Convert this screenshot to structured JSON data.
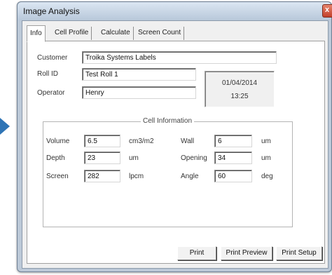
{
  "window": {
    "title": "Image Analysis",
    "close_glyph": "x"
  },
  "tabs": [
    {
      "label": "Info",
      "active": true
    },
    {
      "label": "Cell Profile",
      "active": false
    },
    {
      "label": "Calculate",
      "active": false
    },
    {
      "label": "Screen Count",
      "active": false
    }
  ],
  "info": {
    "customer_label": "Customer",
    "customer_value": "Troika Systems Labels",
    "roll_id_label": "Roll ID",
    "roll_id_value": "Test Roll 1",
    "operator_label": "Operator",
    "operator_value": "Henry",
    "date": "01/04/2014",
    "time": "13:25"
  },
  "cell_information": {
    "title": "Cell Information",
    "volume_label": "Volume",
    "volume_value": "6.5",
    "volume_unit": "cm3/m2",
    "depth_label": "Depth",
    "depth_value": "23",
    "depth_unit": "um",
    "screen_label": "Screen",
    "screen_value": "282",
    "screen_unit": "lpcm",
    "wall_label": "Wall",
    "wall_value": "6",
    "wall_unit": "um",
    "opening_label": "Opening",
    "opening_value": "34",
    "opening_unit": "um",
    "angle_label": "Angle",
    "angle_value": "60",
    "angle_unit": "deg"
  },
  "buttons": {
    "print": "Print",
    "print_preview": "Print Preview",
    "print_setup": "Print Setup"
  },
  "colors": {
    "accent_arrow": "#2e74b5",
    "close_button": "#c3402a"
  }
}
